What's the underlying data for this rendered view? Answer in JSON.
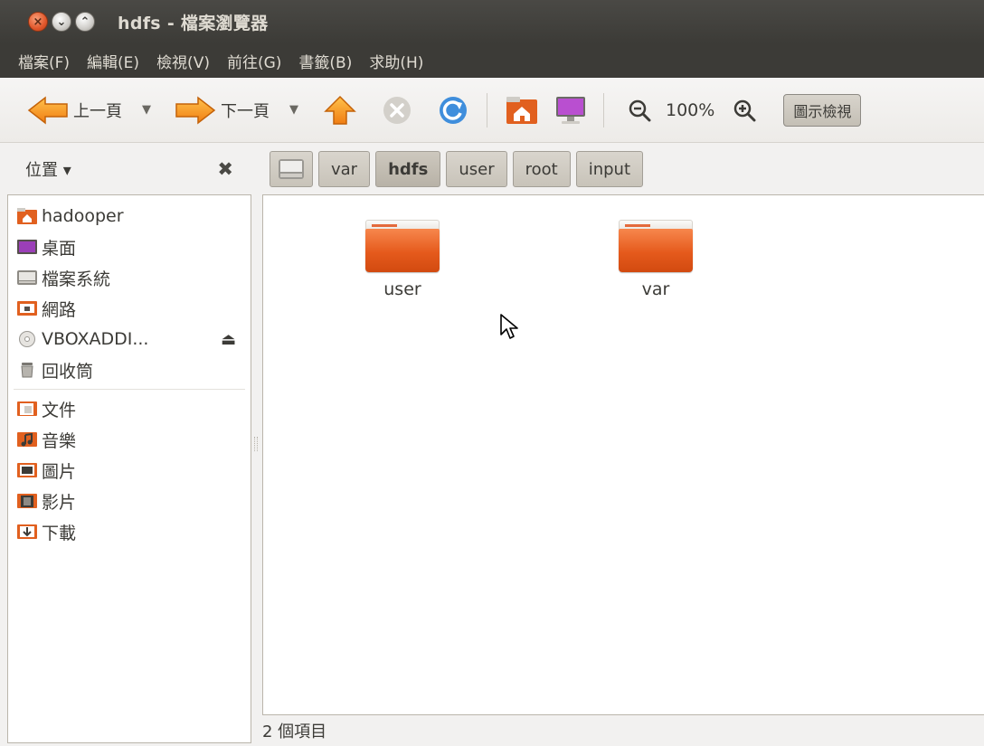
{
  "window": {
    "title": "hdfs - 檔案瀏覽器",
    "buttons": {
      "close": "×",
      "minimize": "⌄",
      "maximize": "⌃"
    }
  },
  "menubar": {
    "items": [
      "檔案(F)",
      "編輯(E)",
      "檢視(V)",
      "前往(G)",
      "書籤(B)",
      "求助(H)"
    ]
  },
  "toolbar": {
    "back_label": "上一頁",
    "forward_label": "下一頁",
    "dropdown_glyph": "▼",
    "zoom_level": "100%",
    "view_mode": "圖示檢視"
  },
  "sidebar": {
    "header": "位置 ▾",
    "close_glyph": "✖",
    "eject_glyph": "⏏",
    "places": [
      {
        "label": "hadooper",
        "icon": "home-folder-icon"
      },
      {
        "label": "桌面",
        "icon": "desktop-icon"
      },
      {
        "label": "檔案系統",
        "icon": "filesystem-icon"
      },
      {
        "label": "網路",
        "icon": "network-icon"
      },
      {
        "label": "VBOXADDI...",
        "icon": "cdrom-icon"
      },
      {
        "label": "回收筒",
        "icon": "trash-icon"
      }
    ],
    "bookmarks": [
      {
        "label": "文件",
        "icon": "documents-folder-icon"
      },
      {
        "label": "音樂",
        "icon": "music-folder-icon"
      },
      {
        "label": "圖片",
        "icon": "pictures-folder-icon"
      },
      {
        "label": "影片",
        "icon": "videos-folder-icon"
      },
      {
        "label": "下載",
        "icon": "downloads-folder-icon"
      }
    ]
  },
  "pathbar": {
    "crumbs": [
      "var",
      "hdfs",
      "user",
      "root",
      "input"
    ],
    "active": "hdfs"
  },
  "files": [
    {
      "name": "user",
      "icon": "folder-icon"
    },
    {
      "name": "var",
      "icon": "folder-icon"
    }
  ],
  "status": {
    "text": "2 個項目"
  },
  "colors": {
    "titlebar": "#3c3b37",
    "accent_orange": "#e55a1c",
    "window_bg": "#f2f1f0"
  }
}
